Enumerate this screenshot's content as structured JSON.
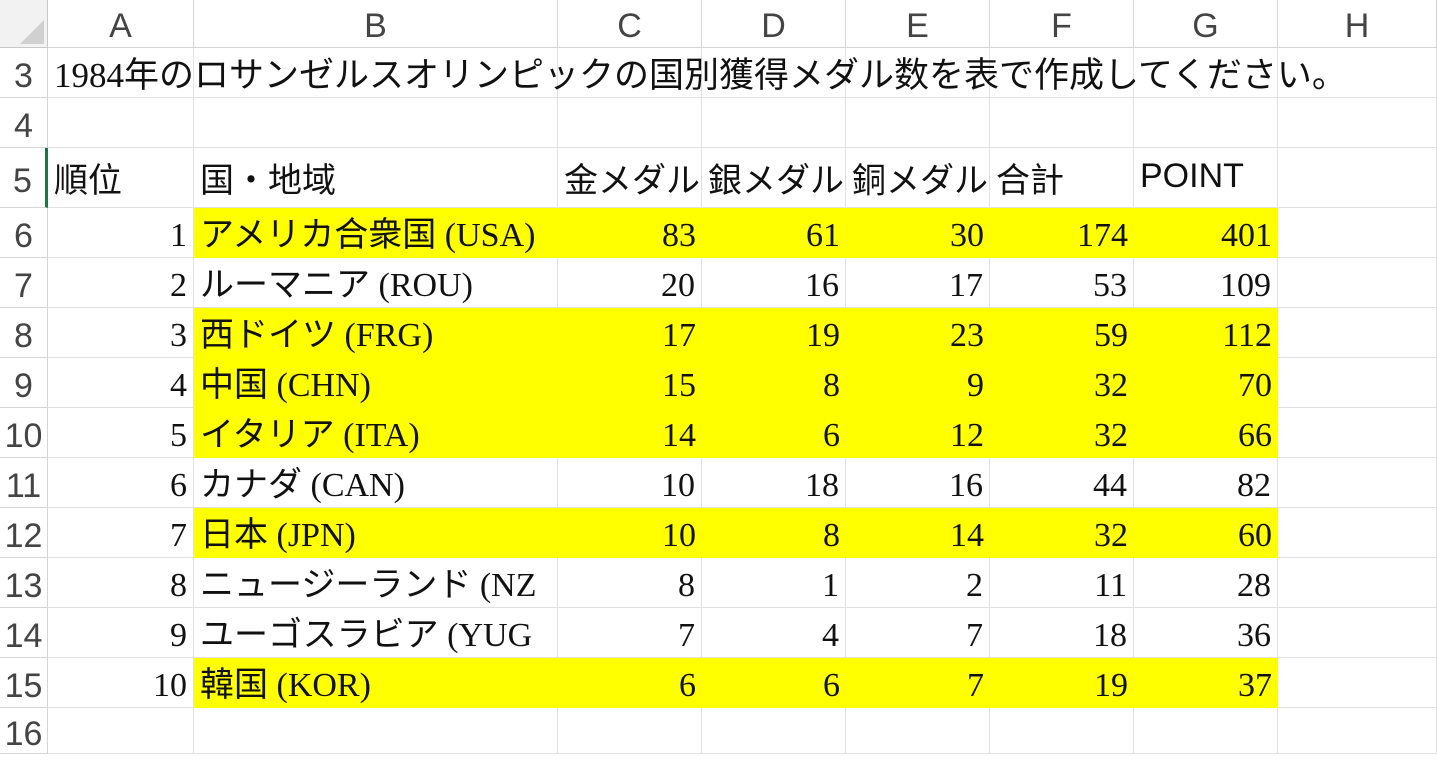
{
  "columns": [
    "A",
    "B",
    "C",
    "D",
    "E",
    "F",
    "G",
    "H"
  ],
  "rows": [
    "3",
    "4",
    "5",
    "6",
    "7",
    "8",
    "9",
    "10",
    "11",
    "12",
    "13",
    "14",
    "15",
    "16"
  ],
  "title_cell": "1984年のロサンゼルスオリンピックの国別獲得メダル数を表で作成してください。",
  "headers": {
    "rank": "順位",
    "country": "国・地域",
    "gold": "金メダル",
    "silver": "銀メダル",
    "bronze": "銅メダル",
    "total": "合計",
    "point": "POINT"
  },
  "table": [
    {
      "rank": "1",
      "country": "アメリカ合衆国 (USA)",
      "gold": "83",
      "silver": "61",
      "bronze": "30",
      "total": "174",
      "point": "401",
      "highlight": true
    },
    {
      "rank": "2",
      "country": "ルーマニア (ROU)",
      "gold": "20",
      "silver": "16",
      "bronze": "17",
      "total": "53",
      "point": "109",
      "highlight": false
    },
    {
      "rank": "3",
      "country": "西ドイツ (FRG)",
      "gold": "17",
      "silver": "19",
      "bronze": "23",
      "total": "59",
      "point": "112",
      "highlight": true
    },
    {
      "rank": "4",
      "country": "中国 (CHN)",
      "gold": "15",
      "silver": "8",
      "bronze": "9",
      "total": "32",
      "point": "70",
      "highlight": true
    },
    {
      "rank": "5",
      "country": "イタリア (ITA)",
      "gold": "14",
      "silver": "6",
      "bronze": "12",
      "total": "32",
      "point": "66",
      "highlight": true
    },
    {
      "rank": "6",
      "country": "カナダ (CAN)",
      "gold": "10",
      "silver": "18",
      "bronze": "16",
      "total": "44",
      "point": "82",
      "highlight": false
    },
    {
      "rank": "7",
      "country": "日本 (JPN)",
      "gold": "10",
      "silver": "8",
      "bronze": "14",
      "total": "32",
      "point": "60",
      "highlight": true
    },
    {
      "rank": "8",
      "country": "ニュージーランド (NZ",
      "gold": "8",
      "silver": "1",
      "bronze": "2",
      "total": "11",
      "point": "28",
      "highlight": false
    },
    {
      "rank": "9",
      "country": "ユーゴスラビア (YUG",
      "gold": "7",
      "silver": "4",
      "bronze": "7",
      "total": "18",
      "point": "36",
      "highlight": false
    },
    {
      "rank": "10",
      "country": "韓国 (KOR)",
      "gold": "6",
      "silver": "6",
      "bronze": "7",
      "total": "19",
      "point": "37",
      "highlight": true
    }
  ],
  "colors": {
    "highlight": "#ffff00",
    "selection": "#217346"
  }
}
